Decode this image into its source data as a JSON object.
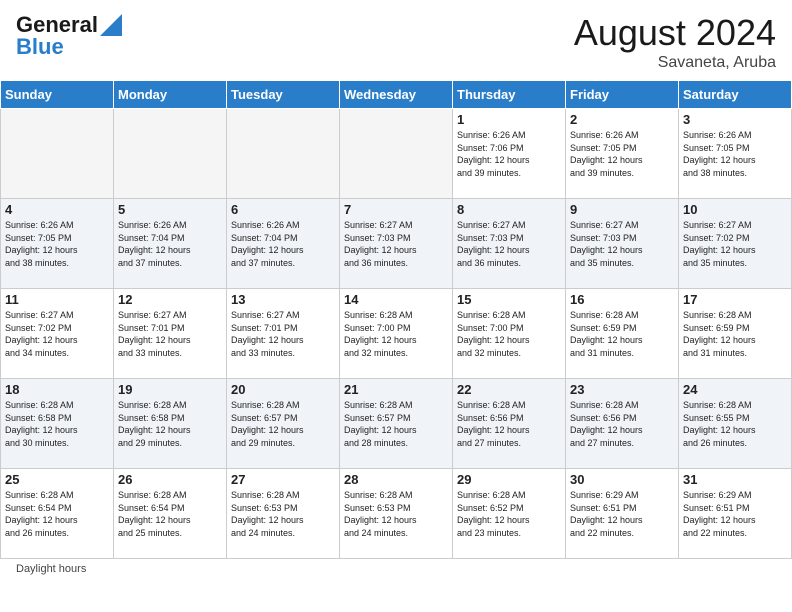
{
  "header": {
    "logo_line1": "General",
    "logo_line2": "Blue",
    "month_year": "August 2024",
    "location": "Savaneta, Aruba"
  },
  "days_of_week": [
    "Sunday",
    "Monday",
    "Tuesday",
    "Wednesday",
    "Thursday",
    "Friday",
    "Saturday"
  ],
  "weeks": [
    [
      {
        "day": "",
        "info": ""
      },
      {
        "day": "",
        "info": ""
      },
      {
        "day": "",
        "info": ""
      },
      {
        "day": "",
        "info": ""
      },
      {
        "day": "1",
        "info": "Sunrise: 6:26 AM\nSunset: 7:06 PM\nDaylight: 12 hours\nand 39 minutes."
      },
      {
        "day": "2",
        "info": "Sunrise: 6:26 AM\nSunset: 7:05 PM\nDaylight: 12 hours\nand 39 minutes."
      },
      {
        "day": "3",
        "info": "Sunrise: 6:26 AM\nSunset: 7:05 PM\nDaylight: 12 hours\nand 38 minutes."
      }
    ],
    [
      {
        "day": "4",
        "info": "Sunrise: 6:26 AM\nSunset: 7:05 PM\nDaylight: 12 hours\nand 38 minutes."
      },
      {
        "day": "5",
        "info": "Sunrise: 6:26 AM\nSunset: 7:04 PM\nDaylight: 12 hours\nand 37 minutes."
      },
      {
        "day": "6",
        "info": "Sunrise: 6:26 AM\nSunset: 7:04 PM\nDaylight: 12 hours\nand 37 minutes."
      },
      {
        "day": "7",
        "info": "Sunrise: 6:27 AM\nSunset: 7:03 PM\nDaylight: 12 hours\nand 36 minutes."
      },
      {
        "day": "8",
        "info": "Sunrise: 6:27 AM\nSunset: 7:03 PM\nDaylight: 12 hours\nand 36 minutes."
      },
      {
        "day": "9",
        "info": "Sunrise: 6:27 AM\nSunset: 7:03 PM\nDaylight: 12 hours\nand 35 minutes."
      },
      {
        "day": "10",
        "info": "Sunrise: 6:27 AM\nSunset: 7:02 PM\nDaylight: 12 hours\nand 35 minutes."
      }
    ],
    [
      {
        "day": "11",
        "info": "Sunrise: 6:27 AM\nSunset: 7:02 PM\nDaylight: 12 hours\nand 34 minutes."
      },
      {
        "day": "12",
        "info": "Sunrise: 6:27 AM\nSunset: 7:01 PM\nDaylight: 12 hours\nand 33 minutes."
      },
      {
        "day": "13",
        "info": "Sunrise: 6:27 AM\nSunset: 7:01 PM\nDaylight: 12 hours\nand 33 minutes."
      },
      {
        "day": "14",
        "info": "Sunrise: 6:28 AM\nSunset: 7:00 PM\nDaylight: 12 hours\nand 32 minutes."
      },
      {
        "day": "15",
        "info": "Sunrise: 6:28 AM\nSunset: 7:00 PM\nDaylight: 12 hours\nand 32 minutes."
      },
      {
        "day": "16",
        "info": "Sunrise: 6:28 AM\nSunset: 6:59 PM\nDaylight: 12 hours\nand 31 minutes."
      },
      {
        "day": "17",
        "info": "Sunrise: 6:28 AM\nSunset: 6:59 PM\nDaylight: 12 hours\nand 31 minutes."
      }
    ],
    [
      {
        "day": "18",
        "info": "Sunrise: 6:28 AM\nSunset: 6:58 PM\nDaylight: 12 hours\nand 30 minutes."
      },
      {
        "day": "19",
        "info": "Sunrise: 6:28 AM\nSunset: 6:58 PM\nDaylight: 12 hours\nand 29 minutes."
      },
      {
        "day": "20",
        "info": "Sunrise: 6:28 AM\nSunset: 6:57 PM\nDaylight: 12 hours\nand 29 minutes."
      },
      {
        "day": "21",
        "info": "Sunrise: 6:28 AM\nSunset: 6:57 PM\nDaylight: 12 hours\nand 28 minutes."
      },
      {
        "day": "22",
        "info": "Sunrise: 6:28 AM\nSunset: 6:56 PM\nDaylight: 12 hours\nand 27 minutes."
      },
      {
        "day": "23",
        "info": "Sunrise: 6:28 AM\nSunset: 6:56 PM\nDaylight: 12 hours\nand 27 minutes."
      },
      {
        "day": "24",
        "info": "Sunrise: 6:28 AM\nSunset: 6:55 PM\nDaylight: 12 hours\nand 26 minutes."
      }
    ],
    [
      {
        "day": "25",
        "info": "Sunrise: 6:28 AM\nSunset: 6:54 PM\nDaylight: 12 hours\nand 26 minutes."
      },
      {
        "day": "26",
        "info": "Sunrise: 6:28 AM\nSunset: 6:54 PM\nDaylight: 12 hours\nand 25 minutes."
      },
      {
        "day": "27",
        "info": "Sunrise: 6:28 AM\nSunset: 6:53 PM\nDaylight: 12 hours\nand 24 minutes."
      },
      {
        "day": "28",
        "info": "Sunrise: 6:28 AM\nSunset: 6:53 PM\nDaylight: 12 hours\nand 24 minutes."
      },
      {
        "day": "29",
        "info": "Sunrise: 6:28 AM\nSunset: 6:52 PM\nDaylight: 12 hours\nand 23 minutes."
      },
      {
        "day": "30",
        "info": "Sunrise: 6:29 AM\nSunset: 6:51 PM\nDaylight: 12 hours\nand 22 minutes."
      },
      {
        "day": "31",
        "info": "Sunrise: 6:29 AM\nSunset: 6:51 PM\nDaylight: 12 hours\nand 22 minutes."
      }
    ]
  ],
  "footer": {
    "daylight_label": "Daylight hours"
  }
}
